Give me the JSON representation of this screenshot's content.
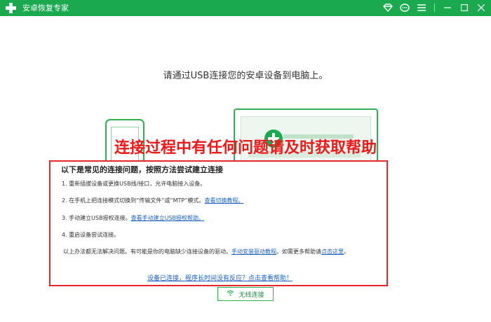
{
  "titlebar": {
    "app_title": "安卓恢复专家"
  },
  "main": {
    "title": "请通过USB连接您的安卓设备到电脑上。"
  },
  "overlay": {
    "text": "连接过程中有任何问题请及时获取帮助"
  },
  "panel": {
    "heading": "以下是常见的连接问题，按照方法尝试建立连接",
    "steps": [
      {
        "text": "1.  重新插拔设备或更换USB线/接口，允许电脑接入设备。",
        "link": ""
      },
      {
        "text": "2.  在手机上把连接模式切换到“传输文件”或“MTP”模式。",
        "link": "查看切换教程。"
      },
      {
        "text": "3.  手动建立USB授权连接。",
        "link": "查看手动建立USB授权帮助。"
      },
      {
        "text": "4.  重启设备尝试连接。",
        "link": ""
      }
    ],
    "footer_before": "以上办法都无法解决问题。有可能是你的电脑缺少连接设备的驱动。",
    "footer_link1": "手动安装驱动教程",
    "footer_middle": "。如需更多帮助请",
    "footer_link2": "点击这里",
    "footer_after": "。",
    "help_link": "设备已连接，程序长时间没有反应？点击查看帮助！"
  },
  "wireless": {
    "label": "无线连接"
  },
  "colors": {
    "brand": "#1aa94f",
    "alert": "#e5262a",
    "link": "#1a5fc4"
  }
}
